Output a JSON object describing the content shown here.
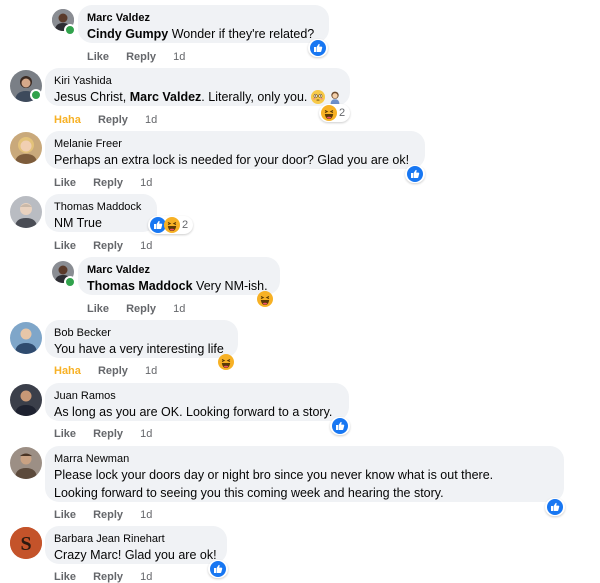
{
  "actions": {
    "like": "Like",
    "haha": "Haha",
    "reply": "Reply"
  },
  "comments": [
    {
      "author": "Marc Valdez",
      "tag": "Cindy Gumpy",
      "text": " Wonder if they're related?",
      "reaction": "Like",
      "time": "1d",
      "react_count": ""
    },
    {
      "author": "Kiri Yashida",
      "pre": "Jesus Christ, ",
      "tag": "Marc Valdez",
      "text": ". Literally, only you.",
      "reaction": "Haha",
      "time": "1d",
      "react_count": "2"
    },
    {
      "author": "Melanie Freer",
      "text": "Perhaps an extra lock is needed for your door? Glad you are ok!",
      "reaction": "Like",
      "time": "1d"
    },
    {
      "author": "Thomas Maddock",
      "text": "NM True",
      "reaction": "Like",
      "time": "1d",
      "react_count": "2"
    },
    {
      "author": "Marc Valdez",
      "tag": "Thomas Maddock",
      "text": " Very NM-ish.",
      "reaction": "Like",
      "time": "1d"
    },
    {
      "author": "Bob Becker",
      "text": "You have a very interesting life",
      "reaction": "Haha",
      "time": "1d"
    },
    {
      "author": "Juan Ramos",
      "text": "As long as you are OK. Looking forward to a story.",
      "reaction": "Like",
      "time": "1d"
    },
    {
      "author": "Marra Newman",
      "text1": "Please lock your doors day or night bro since you never know what is out there.",
      "text2": "Looking forward to seeing you this coming week and hearing the story.",
      "reaction": "Like",
      "time": "1d"
    },
    {
      "author": "Barbara Jean Rinehart",
      "text": "Crazy Marc! Glad you are ok!",
      "reaction": "Like",
      "time": "1d"
    }
  ],
  "colors": {
    "like_blue": "#1877f2",
    "haha_yellow": "#f7b125",
    "bubble": "#f0f2f5",
    "meta": "#65676b"
  }
}
